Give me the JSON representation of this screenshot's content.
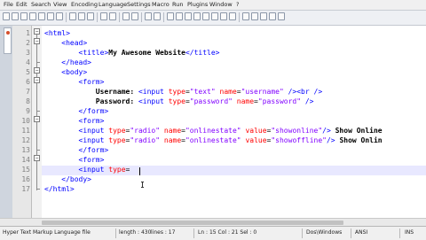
{
  "menu": [
    "File",
    "Edit",
    "Search",
    "View",
    "Encoding",
    "Language",
    "Settings",
    "Macro",
    "Run",
    "Plugins",
    "Window",
    "?"
  ],
  "tabstrip": {
    "label": "tab-file"
  },
  "lines": [
    {
      "n": "1",
      "tokens": [
        {
          "t": "tag",
          "v": "<html>"
        }
      ]
    },
    {
      "n": "2",
      "tokens": [
        {
          "t": "plain",
          "v": "    "
        },
        {
          "t": "tag",
          "v": "<head>"
        }
      ]
    },
    {
      "n": "3",
      "tokens": [
        {
          "t": "plain",
          "v": "        "
        },
        {
          "t": "tag",
          "v": "<title>"
        },
        {
          "t": "txt",
          "v": "My Awesome Website"
        },
        {
          "t": "tag",
          "v": "</title>"
        }
      ]
    },
    {
      "n": "4",
      "tokens": [
        {
          "t": "plain",
          "v": "    "
        },
        {
          "t": "tag",
          "v": "</head>"
        }
      ]
    },
    {
      "n": "5",
      "tokens": [
        {
          "t": "plain",
          "v": "    "
        },
        {
          "t": "tag",
          "v": "<body>"
        }
      ]
    },
    {
      "n": "6",
      "tokens": [
        {
          "t": "plain",
          "v": "        "
        },
        {
          "t": "tag",
          "v": "<form>"
        }
      ]
    },
    {
      "n": "7",
      "tokens": [
        {
          "t": "plain",
          "v": "            "
        },
        {
          "t": "txt",
          "v": "Username: "
        },
        {
          "t": "tag",
          "v": "<input "
        },
        {
          "t": "attr",
          "v": "type"
        },
        {
          "t": "plain",
          "v": "="
        },
        {
          "t": "val",
          "v": "\"text\""
        },
        {
          "t": "plain",
          "v": " "
        },
        {
          "t": "attr",
          "v": "name"
        },
        {
          "t": "plain",
          "v": "="
        },
        {
          "t": "val",
          "v": "\"username\""
        },
        {
          "t": "tag",
          "v": " /><br />"
        }
      ]
    },
    {
      "n": "8",
      "tokens": [
        {
          "t": "plain",
          "v": "            "
        },
        {
          "t": "txt",
          "v": "Password: "
        },
        {
          "t": "tag",
          "v": "<input "
        },
        {
          "t": "attr",
          "v": "type"
        },
        {
          "t": "plain",
          "v": "="
        },
        {
          "t": "val",
          "v": "\"password\""
        },
        {
          "t": "plain",
          "v": " "
        },
        {
          "t": "attr",
          "v": "name"
        },
        {
          "t": "plain",
          "v": "="
        },
        {
          "t": "val",
          "v": "\"password\""
        },
        {
          "t": "tag",
          "v": " />"
        }
      ]
    },
    {
      "n": "9",
      "tokens": [
        {
          "t": "plain",
          "v": "        "
        },
        {
          "t": "tag",
          "v": "</form>"
        }
      ]
    },
    {
      "n": "10",
      "tokens": [
        {
          "t": "plain",
          "v": "        "
        },
        {
          "t": "tag",
          "v": "<form>"
        }
      ]
    },
    {
      "n": "11",
      "tokens": [
        {
          "t": "plain",
          "v": "        "
        },
        {
          "t": "tag",
          "v": "<input "
        },
        {
          "t": "attr",
          "v": "type"
        },
        {
          "t": "plain",
          "v": "="
        },
        {
          "t": "val",
          "v": "\"radio\""
        },
        {
          "t": "plain",
          "v": " "
        },
        {
          "t": "attr",
          "v": "name"
        },
        {
          "t": "plain",
          "v": "="
        },
        {
          "t": "val",
          "v": "\"onlinestate\""
        },
        {
          "t": "plain",
          "v": " "
        },
        {
          "t": "attr",
          "v": "value"
        },
        {
          "t": "plain",
          "v": "="
        },
        {
          "t": "val",
          "v": "\"showonline\""
        },
        {
          "t": "tag",
          "v": "/>"
        },
        {
          "t": "txt",
          "v": " Show Online"
        }
      ]
    },
    {
      "n": "12",
      "tokens": [
        {
          "t": "plain",
          "v": "        "
        },
        {
          "t": "tag",
          "v": "<input "
        },
        {
          "t": "attr",
          "v": "type"
        },
        {
          "t": "plain",
          "v": "="
        },
        {
          "t": "val",
          "v": "\"radio\""
        },
        {
          "t": "plain",
          "v": " "
        },
        {
          "t": "attr",
          "v": "name"
        },
        {
          "t": "plain",
          "v": "="
        },
        {
          "t": "val",
          "v": "\"onlinestate\""
        },
        {
          "t": "plain",
          "v": " "
        },
        {
          "t": "attr",
          "v": "value"
        },
        {
          "t": "plain",
          "v": "="
        },
        {
          "t": "val",
          "v": "\"showoffline\""
        },
        {
          "t": "tag",
          "v": "/>"
        },
        {
          "t": "txt",
          "v": " Show Onlin"
        }
      ]
    },
    {
      "n": "13",
      "tokens": [
        {
          "t": "plain",
          "v": "        "
        },
        {
          "t": "tag",
          "v": "</form>"
        }
      ]
    },
    {
      "n": "14",
      "tokens": [
        {
          "t": "plain",
          "v": "        "
        },
        {
          "t": "tag",
          "v": "<form>"
        }
      ]
    },
    {
      "n": "15",
      "tokens": [
        {
          "t": "plain",
          "v": "        "
        },
        {
          "t": "tag",
          "v": "<input "
        },
        {
          "t": "attr",
          "v": "type"
        },
        {
          "t": "plain",
          "v": "="
        }
      ]
    },
    {
      "n": "16",
      "tokens": [
        {
          "t": "plain",
          "v": "    "
        },
        {
          "t": "tag",
          "v": "</body>"
        }
      ]
    },
    {
      "n": "17",
      "tokens": [
        {
          "t": "tag",
          "v": "</html>"
        }
      ]
    }
  ],
  "status": {
    "filetype": "Hyper Text Markup Language file",
    "length": "length : 430",
    "lines": "lines : 17",
    "cursor": "Ln : 15   Col : 21   Sel : 0",
    "eol": "Dos\\Windows",
    "encoding": "ANSI",
    "mode": "INS"
  },
  "colors": {
    "tag": "#0000ff",
    "attr": "#ff0000",
    "value": "#8000ff",
    "caret_line": "#e8e8ff"
  }
}
